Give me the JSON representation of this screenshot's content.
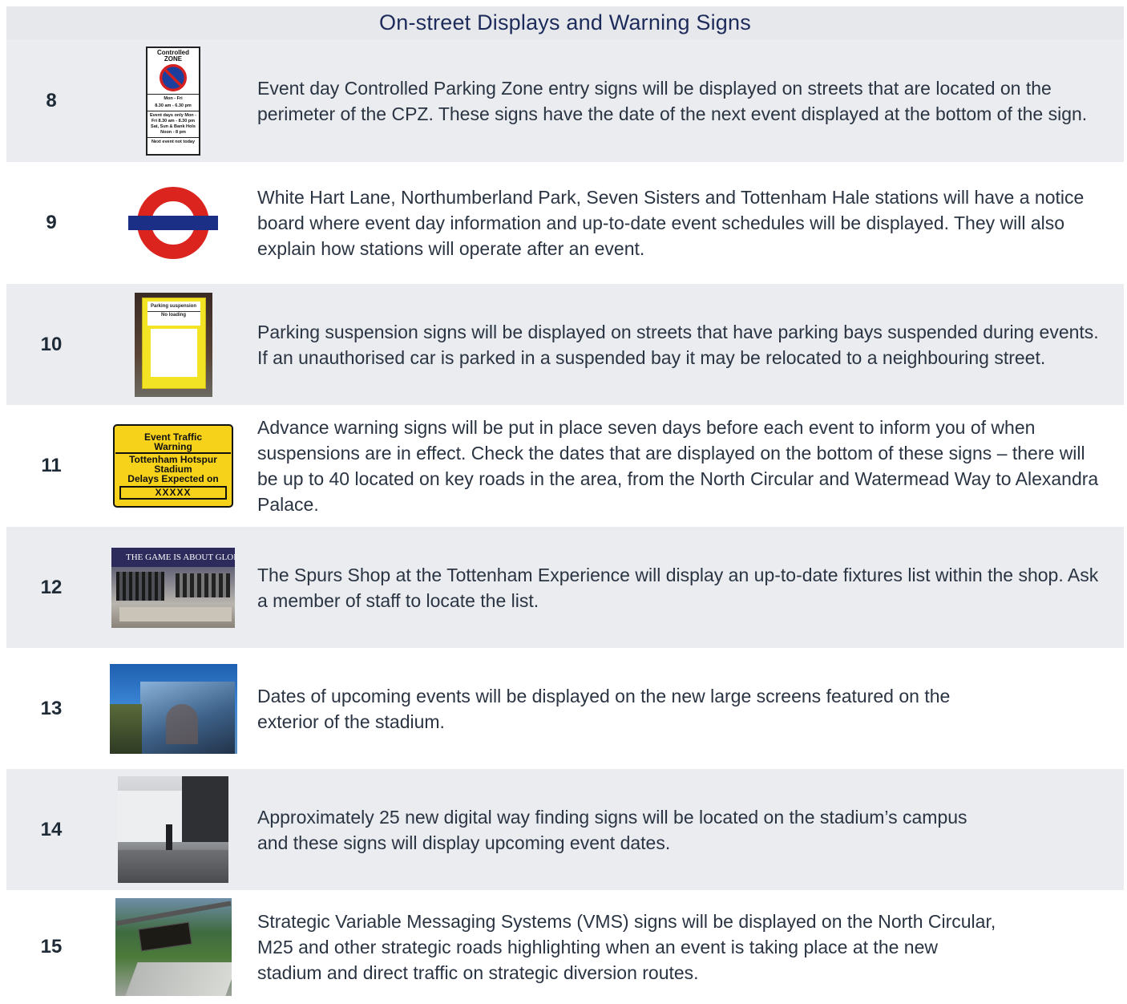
{
  "title": "On-street Displays and Warning Signs",
  "rows": [
    {
      "number": "8",
      "icon": "cpz-entry-sign-icon",
      "description": "Event day Controlled Parking Zone entry signs will be displayed on streets that are located on the perimeter of the CPZ. These signs have the date of the next event displayed at the bottom of the sign."
    },
    {
      "number": "9",
      "icon": "underground-roundel-icon",
      "description": "White Hart Lane, Northumberland Park, Seven Sisters and Tottenham Hale stations will have a notice board where event day information and up-to-date event schedules will be displayed. They will also explain how stations will operate after an event."
    },
    {
      "number": "10",
      "icon": "parking-suspension-sign-photo",
      "description": "Parking suspension signs will be displayed on streets that have parking bays suspended during events. If an unauthorised car is parked in a suspended bay it may be relocated to a neighbouring street."
    },
    {
      "number": "11",
      "icon": "advance-warning-sign-icon",
      "description": "Advance warning signs will be put in place seven days before each event to inform you of when suspensions are in effect. Check the dates that are displayed on the bottom of these signs – there will be up to 40 located on key roads in the area, from the North Circular and Watermead Way to Alexandra Palace."
    },
    {
      "number": "12",
      "icon": "spurs-shop-photo",
      "description": "The Spurs Shop at the Tottenham Experience will display an up-to-date fixtures list within the shop. Ask a member of staff to locate the list."
    },
    {
      "number": "13",
      "icon": "stadium-screen-photo",
      "description": "Dates of upcoming events will be displayed on the new large screens featured on the exterior of the stadium."
    },
    {
      "number": "14",
      "icon": "digital-wayfinding-photo",
      "description": "Approximately 25 new digital way finding signs will be located on the stadium’s campus and these signs will display upcoming event dates."
    },
    {
      "number": "15",
      "icon": "vms-sign-photo",
      "description": "Strategic Variable Messaging Systems (VMS) signs will be displayed on the North Circular, M25 and other strategic roads highlighting when an event is taking place at the new stadium and direct traffic on strategic diversion routes."
    }
  ],
  "cpz_sign": {
    "heading": "Controlled ZONE",
    "line_1": "Mon - Fri",
    "line_2": "8.30 am - 6.30 pm",
    "line_3": "Event days only Mon - Fri 8.30 am - 8.30 pm Sat, Sun & Bank Hols Noon - 8 pm",
    "line_4": "Next event not today"
  },
  "parking_photo_text": {
    "heading": "Parking suspension",
    "subheading": "No loading"
  },
  "warning_sign": {
    "line_1": "Event Traffic",
    "line_2": "Warning",
    "line_3": "Tottenham Hotspur",
    "line_4": "Stadium",
    "line_5": "Delays Expected on",
    "date_box": "XXXXX"
  },
  "shop_banner": "THE GAME IS ABOUT GLORY",
  "colors": {
    "title_text": "#1d2b5a",
    "row_shaded": "#eaecef",
    "roundel_red": "#dc241f",
    "roundel_blue": "#1c2f87",
    "warning_yellow": "#f7d21a"
  }
}
